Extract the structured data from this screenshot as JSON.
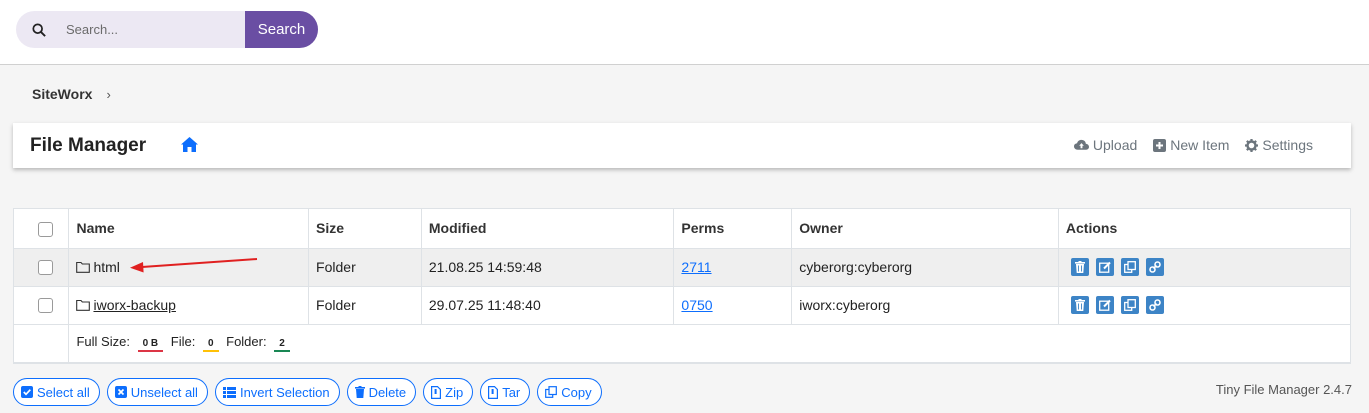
{
  "search": {
    "placeholder": "Search...",
    "button_label": "Search"
  },
  "breadcrumb": {
    "root": "SiteWorx",
    "separator": "›"
  },
  "header": {
    "title": "File Manager",
    "actions": [
      {
        "label": "Upload",
        "icon": "cloud-upload-icon"
      },
      {
        "label": "New Item",
        "icon": "plus-square-icon"
      },
      {
        "label": "Settings",
        "icon": "gear-icon"
      }
    ]
  },
  "table": {
    "columns": [
      "Name",
      "Size",
      "Modified",
      "Perms",
      "Owner",
      "Actions"
    ],
    "rows": [
      {
        "name": "html",
        "size": "Folder",
        "modified": "21.08.25 14:59:48",
        "perms": "2711",
        "owner": "cyberorg:cyberorg"
      },
      {
        "name": "iworx-backup",
        "size": "Folder",
        "modified": "29.07.25 11:48:40",
        "perms": "0750",
        "owner": "iworx:cyberorg"
      }
    ],
    "footer": {
      "full_size_label": "Full Size:",
      "full_size_value": "0 B",
      "file_label": "File:",
      "file_value": "0",
      "folder_label": "Folder:",
      "folder_value": "2"
    }
  },
  "bulk_actions": [
    "Select all",
    "Unselect all",
    "Invert Selection",
    "Delete",
    "Zip",
    "Tar",
    "Copy"
  ],
  "version": "Tiny File Manager 2.4.7",
  "colors": {
    "accent": "#6a4ea3",
    "link": "#0d6efd",
    "action_btn": "#3d84c6"
  }
}
